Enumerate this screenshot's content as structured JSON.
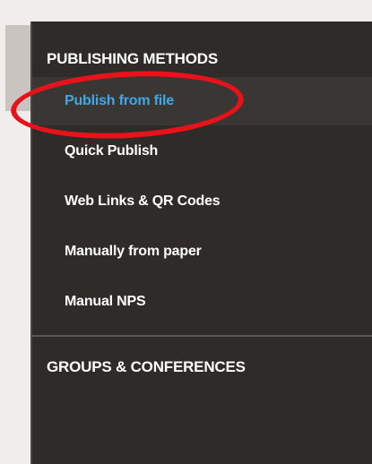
{
  "menu": {
    "publishing_methods_title": "PUBLISHING METHODS",
    "items": [
      {
        "label": "Publish from file",
        "active": true
      },
      {
        "label": "Quick Publish",
        "active": false
      },
      {
        "label": "Web Links & QR Codes",
        "active": false
      },
      {
        "label": "Manually from paper",
        "active": false
      },
      {
        "label": "Manual NPS",
        "active": false
      }
    ],
    "groups_title": "GROUPS & CONFERENCES"
  },
  "colors": {
    "menu_bg": "#2e2b29",
    "active_text": "#3fa9e8",
    "annotation": "#e8131a"
  }
}
